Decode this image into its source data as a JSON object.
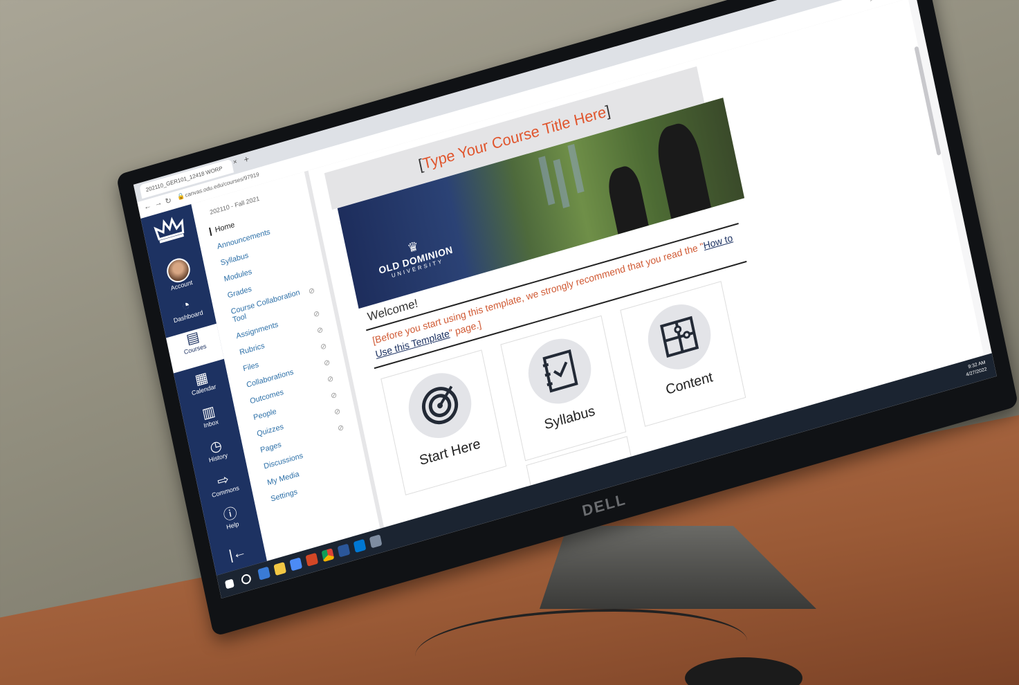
{
  "browser": {
    "tab_title": "202110_GER101_12418 WORP",
    "tab_close": "×",
    "new_tab": "+",
    "url": "canvas.odu.edu/courses/97919",
    "icons": [
      "back-icon",
      "forward-icon",
      "reload-icon",
      "lock-icon",
      "zoom-icon",
      "share-icon",
      "star-icon"
    ]
  },
  "global_nav": {
    "items": [
      {
        "label": "Account",
        "icon": "account-avatar"
      },
      {
        "label": "Dashboard",
        "icon": "dashboard-icon"
      },
      {
        "label": "Courses",
        "icon": "courses-icon",
        "active": true
      },
      {
        "label": "Calendar",
        "icon": "calendar-icon"
      },
      {
        "label": "Inbox",
        "icon": "inbox-icon"
      },
      {
        "label": "History",
        "icon": "history-icon"
      },
      {
        "label": "Commons",
        "icon": "commons-icon"
      },
      {
        "label": "Help",
        "icon": "help-icon"
      }
    ],
    "collapse_glyph": "|←"
  },
  "course_nav": {
    "term": "202110 - Fall 2021",
    "items": [
      {
        "label": "Home",
        "current": true
      },
      {
        "label": "Announcements"
      },
      {
        "label": "Syllabus"
      },
      {
        "label": "Modules"
      },
      {
        "label": "Grades"
      },
      {
        "label": "Course Collaboration Tool",
        "hidden": true
      },
      {
        "label": "Assignments",
        "hidden": true
      },
      {
        "label": "Rubrics",
        "hidden": true
      },
      {
        "label": "Files",
        "hidden": true
      },
      {
        "label": "Collaborations",
        "hidden": true
      },
      {
        "label": "Outcomes",
        "hidden": true
      },
      {
        "label": "People",
        "hidden": true
      },
      {
        "label": "Quizzes",
        "hidden": true
      },
      {
        "label": "Pages",
        "hidden": true
      },
      {
        "label": "Discussions"
      },
      {
        "label": "My Media"
      },
      {
        "label": "Settings"
      }
    ]
  },
  "page": {
    "title_open": "[",
    "title": "Type Your Course Title Here",
    "title_close": "]",
    "banner": {
      "logo_name": "OLD DOMINION",
      "logo_sub": "UNIVERSITY"
    },
    "welcome": "Welcome!",
    "intro_before": "[Before you start using this template, we strongly recommend that you read the \"",
    "intro_link": "How to Use this Template",
    "intro_after": "\" page.]",
    "tiles": [
      {
        "label": "Start Here",
        "icon": "target-icon"
      },
      {
        "label": "Syllabus",
        "icon": "notebook-check-icon"
      },
      {
        "label": "Content",
        "icon": "puzzle-icon"
      }
    ]
  },
  "taskbar": {
    "time": "9:32 AM",
    "date": "4/27/2022"
  },
  "monitor": {
    "brand": "DELL"
  },
  "colors": {
    "canvas_nav": "#1d3262",
    "accent": "#e0562e",
    "link": "#2d70a8"
  }
}
